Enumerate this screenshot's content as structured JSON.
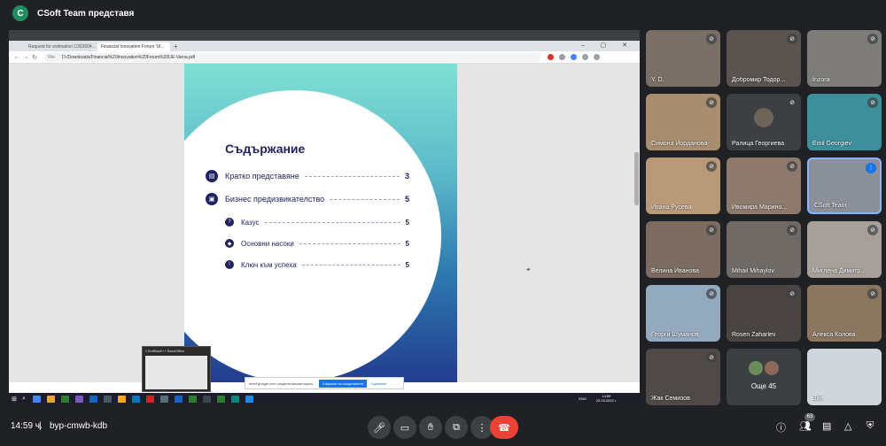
{
  "header": {
    "presenter_initial": "C",
    "presenter_title": "CSoft Team представя"
  },
  "browser": {
    "tabs": [
      {
        "label": "Request for estimation C302604..."
      },
      {
        "label": "Financial Innovation Forum 'Ul..."
      }
    ],
    "new_tab": "+",
    "window_controls": "–  ▢  ✕",
    "url_info": "File",
    "url": "D:/Downloads/Financial%20Innovation%20Forum%20UE-Varna.pdf"
  },
  "pdf": {
    "toc_title": "Съдържание",
    "items": [
      {
        "label": "Кратко представяне",
        "page": "3",
        "icon": "book-icon"
      },
      {
        "label": "Бизнес предизвикателство",
        "page": "5",
        "icon": "briefcase-icon"
      },
      {
        "label": "Казус",
        "page": "5",
        "icon": "question-icon"
      },
      {
        "label": "Основни насоки",
        "page": "5",
        "icon": "direction-icon"
      },
      {
        "label": "Ключ към успеха",
        "page": "5",
        "icon": "alert-icon"
      }
    ]
  },
  "share_bar": {
    "text": "meet.google.com споделя вашия екран.",
    "stop_label": "Спиране на споделянето",
    "hide_label": "Скриване"
  },
  "thumbnail": {
    "title": "CSoftBank++ BackOffice"
  },
  "taskbar": {
    "tray": "ENG",
    "time": "14:59",
    "date": "22.03.2022 г."
  },
  "participants": [
    {
      "name": "Y. D.",
      "muted": true,
      "bg": "#7a6f66"
    },
    {
      "name": "Добромир Тодор...",
      "muted": true,
      "bg": "#5b5350"
    },
    {
      "name": "Inzora",
      "muted": true,
      "bg": "#7d7c78"
    },
    {
      "name": "Симона Йорданова",
      "muted": true,
      "bg": "#a88c6e"
    },
    {
      "name": "Ралица Георгиева",
      "muted": true,
      "bg": "#3c4043",
      "avatar": true,
      "avatar_color": "#6d6358"
    },
    {
      "name": "Emil Georgiev",
      "muted": true,
      "bg": "#3d8f9b"
    },
    {
      "name": "Ивана Русева",
      "muted": true,
      "bg": "#b99a78"
    },
    {
      "name": "Ивомира Марино...",
      "muted": true,
      "bg": "#8e7a6c"
    },
    {
      "name": "CSoft Team",
      "muted": false,
      "bg": "#8a8f98",
      "highlight": true
    },
    {
      "name": "Велина Иванова",
      "muted": true,
      "bg": "#7b6b60"
    },
    {
      "name": "Mihail Mihaylov",
      "muted": true,
      "bg": "#6f6a66"
    },
    {
      "name": "Миглена Димитр...",
      "muted": true,
      "bg": "#a7a09a"
    },
    {
      "name": "Георги Шуманов",
      "muted": true,
      "bg": "#93a9bd"
    },
    {
      "name": "Rosen Zaharlev",
      "muted": true,
      "bg": "#4a4542"
    },
    {
      "name": "Алекса Колова",
      "muted": true,
      "bg": "#8b7760"
    },
    {
      "name": "Жак Семизов",
      "muted": true,
      "bg": "#4f4a47"
    },
    {
      "name": "Още 45",
      "muted": false,
      "bg": "#3c4043",
      "more": true
    },
    {
      "name": "Вие",
      "muted": false,
      "bg": "#cfd6dc"
    }
  ],
  "bottom": {
    "time": "14:59 ч.",
    "separator": "|",
    "meeting_code": "byp-cmwb-kdb",
    "participant_count": "63"
  },
  "colors": {
    "background": "#202124",
    "end_call": "#ea4335",
    "accent": "#1a73e8"
  }
}
